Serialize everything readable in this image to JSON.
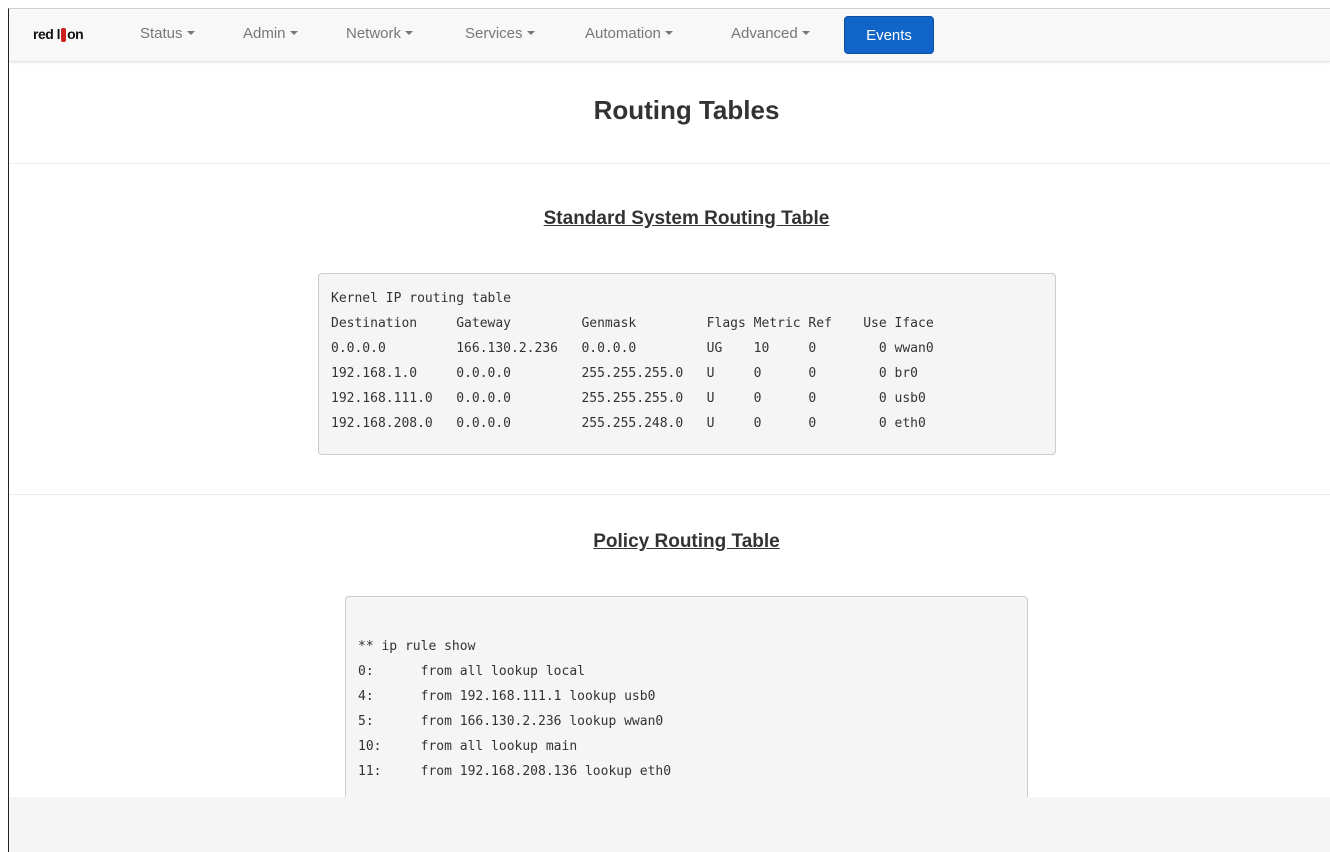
{
  "navbar": {
    "brand_left": "red",
    "brand_right": "on",
    "items": [
      {
        "label": "Status"
      },
      {
        "label": "Admin"
      },
      {
        "label": "Network"
      },
      {
        "label": "Services"
      },
      {
        "label": "Automation"
      },
      {
        "label": "Advanced"
      }
    ],
    "events_label": "Events",
    "events_color": "#1164c8"
  },
  "page": {
    "title": "Routing Tables"
  },
  "standard_table": {
    "title": "Standard System Routing Table",
    "lines": [
      "Kernel IP routing table",
      "Destination     Gateway         Genmask         Flags Metric Ref    Use Iface",
      "0.0.0.0         166.130.2.236   0.0.0.0         UG    10     0        0 wwan0",
      "192.168.1.0     0.0.0.0         255.255.255.0   U     0      0        0 br0",
      "192.168.111.0   0.0.0.0         255.255.255.0   U     0      0        0 usb0",
      "192.168.208.0   0.0.0.0         255.255.248.0   U     0      0        0 eth0"
    ]
  },
  "policy_table": {
    "title": "Policy Routing Table",
    "lines": [
      "",
      "** ip rule show",
      "0:      from all lookup local",
      "4:      from 192.168.111.1 lookup usb0",
      "5:      from 166.130.2.236 lookup wwan0",
      "10:     from all lookup main",
      "11:     from 192.168.208.136 lookup eth0"
    ]
  }
}
